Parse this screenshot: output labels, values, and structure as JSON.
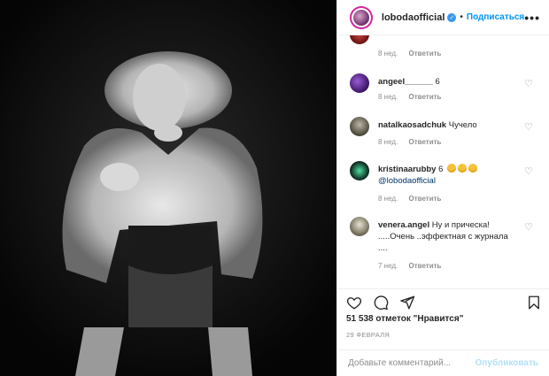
{
  "post": {
    "username": "lobodaofficial",
    "follow_label": "Подписаться",
    "dot": "•",
    "more_label": "•••"
  },
  "comments": [
    {
      "user": "",
      "text": "",
      "time": "8 нед.",
      "reply": "Ответить"
    },
    {
      "user": "angeel______",
      "text": "6",
      "time": "8 нед.",
      "reply": "Ответить"
    },
    {
      "user": "natalkaosadchuk",
      "text": "Чучело",
      "time": "8 нед.",
      "reply": "Ответить"
    },
    {
      "user": "kristinaarubby",
      "text": "6",
      "mention": "@lobodaofficial",
      "time": "8 нед.",
      "reply": "Ответить"
    },
    {
      "user": "venera.angel",
      "text": "Ну и прическа!",
      "text2": ".....Очень ..эффектная с журнала",
      "text3": "....",
      "time": "7 нед.",
      "reply": "Ответить"
    }
  ],
  "icons": {
    "like": "heart-icon",
    "comment": "comment-icon",
    "share": "paper-plane-icon",
    "save": "bookmark-icon"
  },
  "likes_text": "51 538 отметок \"Нравится\"",
  "date_text": "29 ФЕВРАЛЯ",
  "add_comment": {
    "placeholder": "Добавьте комментарий...",
    "publish_label": "Опубликовать"
  },
  "colors": {
    "accent": "#0095f6",
    "verified": "#3897f0",
    "publish_disabled": "#b2dffc",
    "meta": "#8e8e8e"
  }
}
